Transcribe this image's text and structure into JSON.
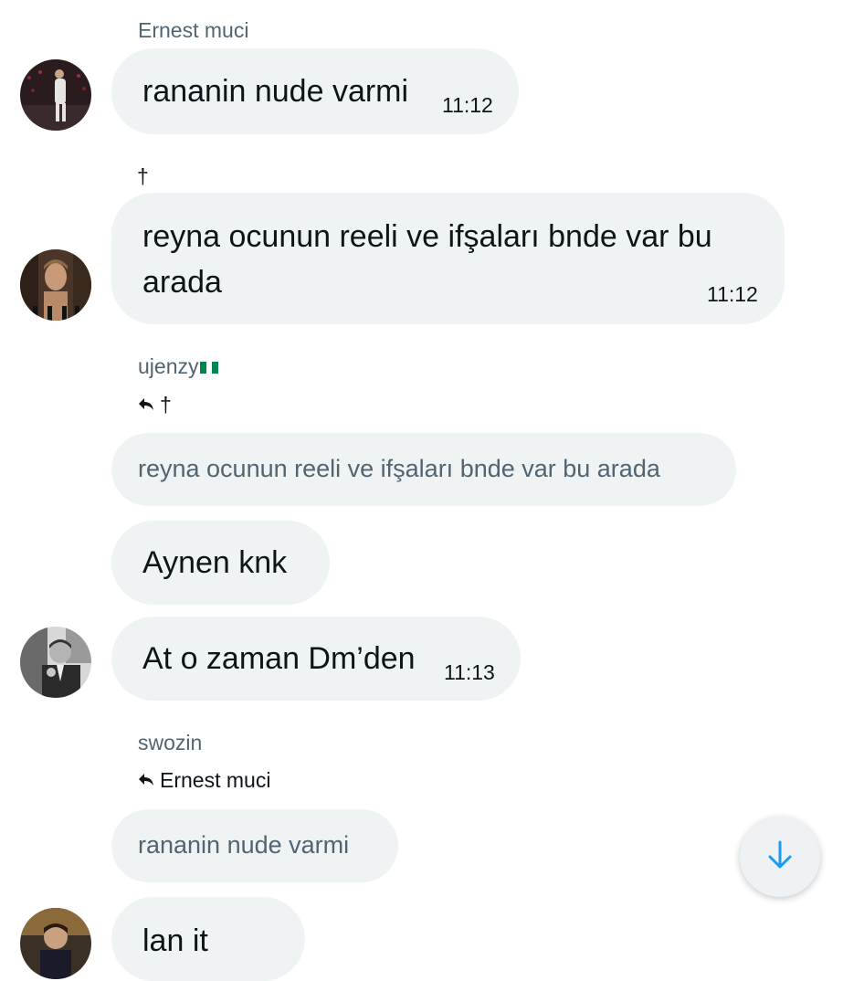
{
  "messages": [
    {
      "sender": "Ernest muci",
      "text": "rananin nude varmi",
      "time": "11:12"
    },
    {
      "sender": "†",
      "text_line1": "reyna ocunun reeli ve ifşaları bnde var bu",
      "text_line2": "arada",
      "time": "11:12"
    },
    {
      "sender": "ujenzy",
      "sender_flag": "nigeria-flag",
      "reply_target": "†",
      "quoted": "reyna ocunun reeli ve ifşaları bnde var bu arada",
      "text_a": "Aynen knk",
      "text_b": "At o zaman Dm’den",
      "time": "11:13"
    },
    {
      "sender": "swozin",
      "reply_target": "Ernest muci",
      "quoted": "rananin nude varmi",
      "text": "lan it"
    }
  ],
  "icons": {
    "reply": "reply-arrow-icon",
    "scroll": "arrow-down-icon"
  },
  "colors": {
    "bubble": "#eff3f4",
    "secondary_text": "#536471",
    "accent": "#1d9bf0",
    "flag_green": "#008751"
  }
}
